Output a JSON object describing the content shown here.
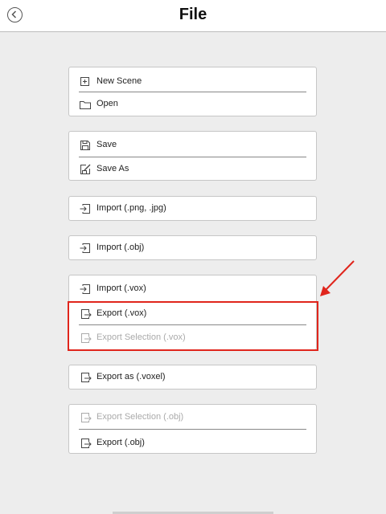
{
  "header": {
    "title": "File",
    "back_icon": "back-chevron-icon"
  },
  "groups": [
    {
      "items": [
        {
          "label": "New Scene",
          "icon": "plus-square-icon"
        },
        {
          "label": "Open",
          "icon": "folder-icon"
        }
      ]
    },
    {
      "items": [
        {
          "label": "Save",
          "icon": "floppy-icon"
        },
        {
          "label": "Save As",
          "icon": "edit-save-icon"
        }
      ]
    },
    {
      "items": [
        {
          "label": "Import (.png, .jpg)",
          "icon": "import-icon"
        }
      ]
    },
    {
      "items": [
        {
          "label": "Import (.obj)",
          "icon": "import-icon"
        }
      ]
    },
    {
      "items": [
        {
          "label": "Import (.vox)",
          "icon": "import-icon"
        },
        {
          "label": "Export (.vox)",
          "icon": "export-icon"
        },
        {
          "label": "Export Selection (.vox)",
          "icon": "export-icon",
          "disabled": true
        }
      ]
    },
    {
      "items": [
        {
          "label": "Export as (.voxel)",
          "icon": "export-icon"
        }
      ]
    },
    {
      "items": [
        {
          "label": "Export Selection (.obj)",
          "icon": "export-icon",
          "disabled": true
        },
        {
          "label": "Export (.obj)",
          "icon": "export-icon"
        }
      ]
    }
  ],
  "colors": {
    "highlight": "#e0251c",
    "background": "#ededed",
    "disabled_text": "#aaaaaa"
  }
}
